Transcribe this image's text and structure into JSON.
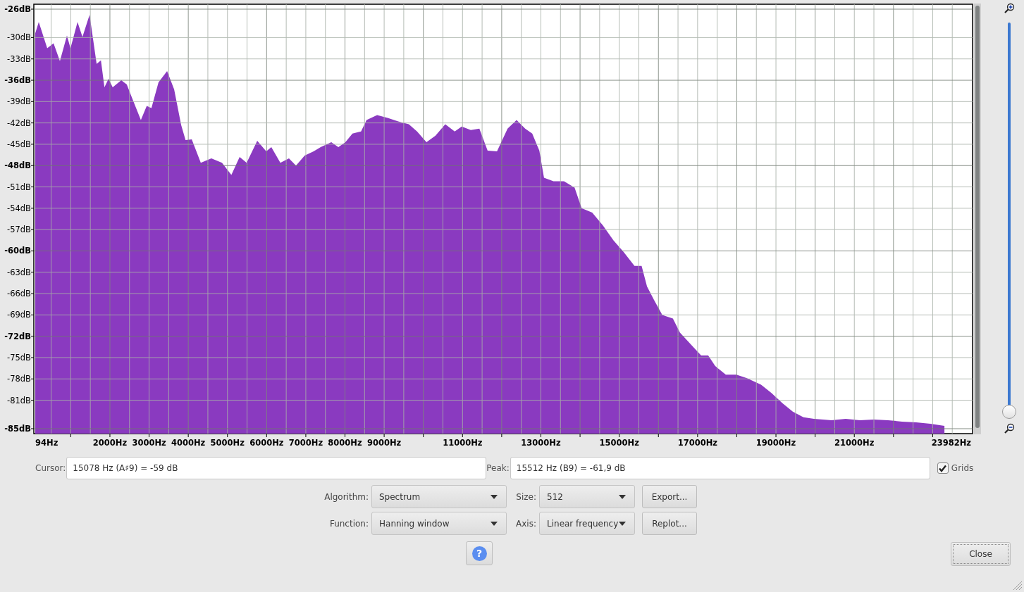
{
  "spectrum_plot": {
    "chart_data": {
      "type": "area",
      "grid": true,
      "x": [
        94,
        184,
        400,
        562,
        724,
        904,
        994,
        1173,
        1300,
        1480,
        1660,
        1770,
        1860,
        1965,
        2070,
        2290,
        2430,
        2580,
        2790,
        2940,
        3060,
        3240,
        3460,
        3640,
        3820,
        3930,
        4090,
        4320,
        4590,
        4860,
        5100,
        5310,
        5490,
        5760,
        5990,
        6120,
        6350,
        6570,
        6750,
        6970,
        7200,
        7380,
        7650,
        7830,
        8010,
        8190,
        8410,
        8550,
        8820,
        9090,
        9360,
        9630,
        9840,
        10080,
        10310,
        10560,
        10800,
        10980,
        11210,
        11430,
        11640,
        11880,
        12150,
        12380,
        12600,
        12780,
        12960,
        13080,
        13320,
        13590,
        13860,
        14040,
        14310,
        14580,
        14850,
        15120,
        15390,
        15570,
        15710,
        15890,
        16100,
        16370,
        16550,
        16820,
        17090,
        17270,
        17450,
        17720,
        17990,
        18260,
        18620,
        18890,
        19160,
        19430,
        19700,
        19970,
        20420,
        20780,
        21140,
        21500,
        21860,
        22220,
        22580,
        22940,
        23300
      ],
      "series": [
        {
          "color": "#8a3ac0",
          "values": [
            -29.4,
            -27.8,
            -31.5,
            -30.8,
            -33.3,
            -29.7,
            -31.5,
            -27.8,
            -29.9,
            -26.8,
            -33.7,
            -33.2,
            -37.0,
            -35.8,
            -37.0,
            -36.0,
            -36.6,
            -38.7,
            -41.6,
            -39.6,
            -39.9,
            -36.3,
            -34.7,
            -37.3,
            -42.3,
            -44.4,
            -44.3,
            -47.6,
            -47.0,
            -47.6,
            -49.3,
            -46.8,
            -47.6,
            -44.5,
            -46.0,
            -45.4,
            -47.6,
            -47.0,
            -48.0,
            -46.6,
            -46.0,
            -45.4,
            -44.7,
            -45.4,
            -44.7,
            -43.5,
            -43.2,
            -41.6,
            -40.9,
            -41.3,
            -41.8,
            -42.2,
            -43.2,
            -44.7,
            -43.8,
            -42.2,
            -43.2,
            -42.5,
            -43.0,
            -42.8,
            -45.9,
            -46.0,
            -42.8,
            -41.6,
            -42.8,
            -43.5,
            -45.9,
            -49.7,
            -50.2,
            -50.2,
            -51.1,
            -54.0,
            -54.6,
            -56.4,
            -58.5,
            -60.2,
            -62.1,
            -62.1,
            -65.0,
            -66.9,
            -69.0,
            -69.5,
            -71.5,
            -73.1,
            -74.7,
            -74.7,
            -76.2,
            -77.4,
            -77.4,
            -77.9,
            -78.8,
            -80.0,
            -81.4,
            -82.6,
            -83.4,
            -83.6,
            -83.8,
            -83.6,
            -83.8,
            -83.7,
            -83.8,
            -84.0,
            -84.1,
            -84.3,
            -84.6
          ]
        }
      ],
      "xlim": [
        94,
        23982
      ],
      "ylim": [
        -85,
        -26
      ],
      "xticks": [
        {
          "value": 94,
          "label": "94Hz"
        },
        {
          "value": 2000,
          "label": "2000Hz"
        },
        {
          "value": 3000,
          "label": "3000Hz"
        },
        {
          "value": 4000,
          "label": "4000Hz"
        },
        {
          "value": 5000,
          "label": "5000Hz"
        },
        {
          "value": 6000,
          "label": "6000Hz"
        },
        {
          "value": 7000,
          "label": "7000Hz"
        },
        {
          "value": 8000,
          "label": "8000Hz"
        },
        {
          "value": 9000,
          "label": "9000Hz"
        },
        {
          "value": 11000,
          "label": "11000Hz"
        },
        {
          "value": 13000,
          "label": "13000Hz"
        },
        {
          "value": 15000,
          "label": "15000Hz"
        },
        {
          "value": 17000,
          "label": "17000Hz"
        },
        {
          "value": 19000,
          "label": "19000Hz"
        },
        {
          "value": 21000,
          "label": "21000Hz"
        },
        {
          "value": 23982,
          "label": "23982Hz"
        }
      ],
      "yticks": [
        {
          "value": -26,
          "label": "-26dB"
        },
        {
          "value": -30,
          "label": "-30dB"
        },
        {
          "value": -33,
          "label": "-33dB"
        },
        {
          "value": -36,
          "label": "-36dB"
        },
        {
          "value": -39,
          "label": "-39dB"
        },
        {
          "value": -42,
          "label": "-42dB"
        },
        {
          "value": -45,
          "label": "-45dB"
        },
        {
          "value": -48,
          "label": "-48dB"
        },
        {
          "value": -51,
          "label": "-51dB"
        },
        {
          "value": -54,
          "label": "-54dB"
        },
        {
          "value": -57,
          "label": "-57dB"
        },
        {
          "value": -60,
          "label": "-60dB"
        },
        {
          "value": -63,
          "label": "-63dB"
        },
        {
          "value": -66,
          "label": "-66dB"
        },
        {
          "value": -69,
          "label": "-69dB"
        },
        {
          "value": -72,
          "label": "-72dB"
        },
        {
          "value": -75,
          "label": "-75dB"
        },
        {
          "value": -78,
          "label": "-78dB"
        },
        {
          "value": -81,
          "label": "-81dB"
        },
        {
          "value": -85,
          "label": "-85dB"
        }
      ]
    }
  },
  "zoom_slider": {
    "level": 0
  },
  "cursor": {
    "label": "Cursor:",
    "value": "15078 Hz (A♯9) = -59 dB"
  },
  "peak": {
    "label": "Peak:",
    "value": "15512 Hz (B9) = -61,9 dB"
  },
  "grids": {
    "label": "Grids",
    "checked": true
  },
  "algorithm": {
    "label": "Algorithm:",
    "value": "Spectrum"
  },
  "size": {
    "label": "Size:",
    "value": "512"
  },
  "export_button": "Export...",
  "function": {
    "label": "Function:",
    "value": "Hanning window"
  },
  "axis": {
    "label": "Axis:",
    "value": "Linear frequency"
  },
  "replot_button": "Replot...",
  "help_button": "?",
  "close_button": "Close"
}
